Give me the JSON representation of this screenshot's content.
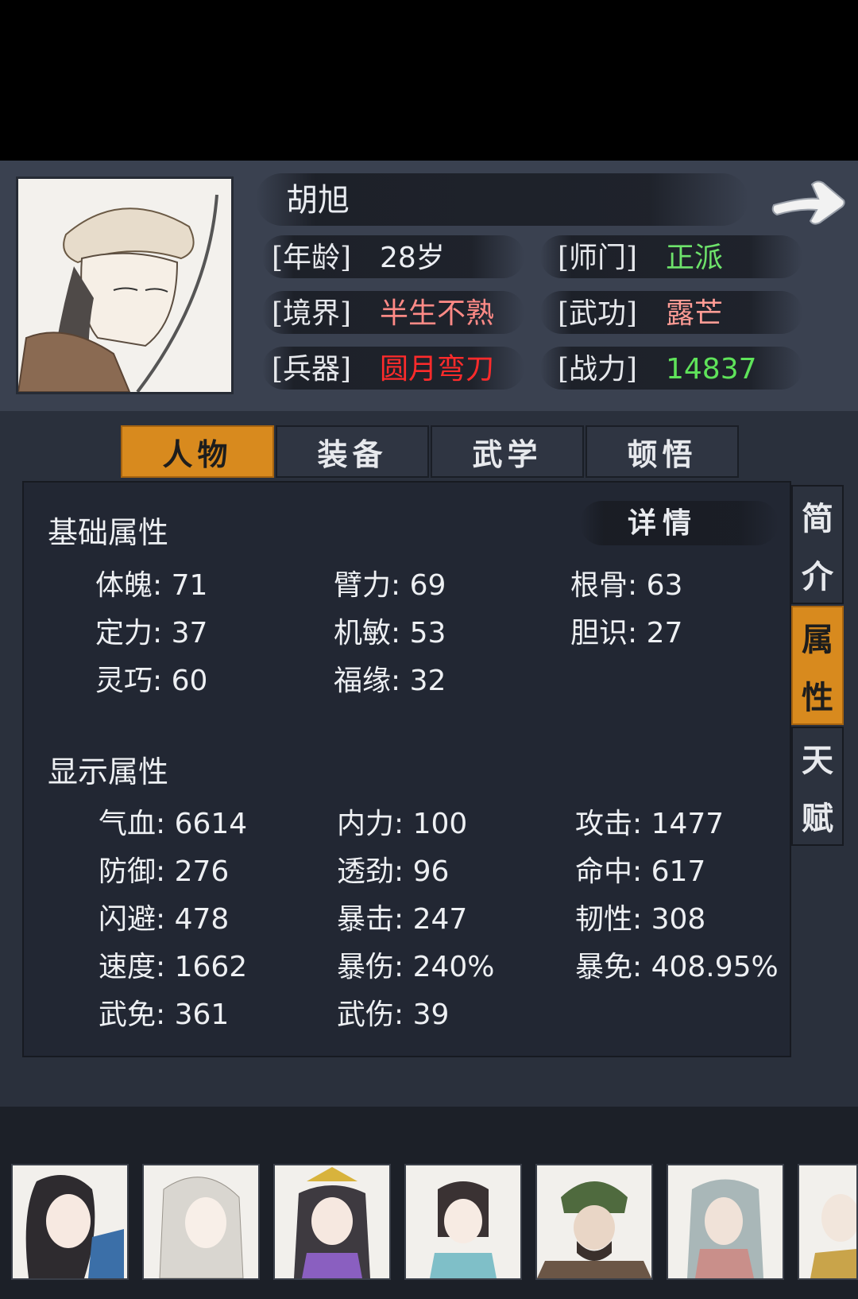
{
  "character": {
    "name": "胡旭",
    "info": [
      {
        "label": "[年龄]",
        "value": "28岁",
        "color": "#eceff3"
      },
      {
        "label": "[师门]",
        "value": "正派",
        "color": "#6ee36b"
      },
      {
        "label": "[境界]",
        "value": "半生不熟",
        "color": "#ff8a86"
      },
      {
        "label": "[武功]",
        "value": "露芒",
        "color": "#ff9c95"
      },
      {
        "label": "[兵器]",
        "value": "圆月弯刀",
        "color": "#ff2b2b"
      },
      {
        "label": "[战力]",
        "value": "14837",
        "color": "#5fe35a"
      }
    ]
  },
  "tabs": [
    "人物",
    "装备",
    "武学",
    "顿悟"
  ],
  "active_tab": "人物",
  "detail_label": "详情",
  "side_tabs": [
    {
      "chars": [
        "简",
        "介"
      ],
      "active": false
    },
    {
      "chars": [
        "属",
        "性"
      ],
      "active": true
    },
    {
      "chars": [
        "天",
        "赋"
      ],
      "active": false
    }
  ],
  "base_attrs": {
    "title": "基础属性",
    "items": [
      "体魄: 71",
      "臂力: 69",
      "根骨: 63",
      "定力: 37",
      "机敏: 53",
      "胆识: 27",
      "灵巧: 60",
      "福缘: 32"
    ]
  },
  "display_attrs": {
    "title": "显示属性",
    "items": [
      "气血: 6614",
      "内力: 100",
      "攻击: 1477",
      "防御: 276",
      "透劲: 96",
      "命中: 617",
      "闪避: 478",
      "暴击: 247",
      "韧性: 308",
      "速度: 1662",
      "暴伤: 240%",
      "暴免: 408.95%",
      "武免: 361",
      "武伤: 39"
    ]
  },
  "party_avatars": [
    "avatar-1",
    "avatar-2",
    "avatar-3",
    "avatar-4",
    "avatar-5",
    "avatar-6",
    "avatar-7"
  ],
  "colors": {
    "accent": "#d88a1e",
    "panel": "#222733",
    "header": "#3a4150"
  }
}
